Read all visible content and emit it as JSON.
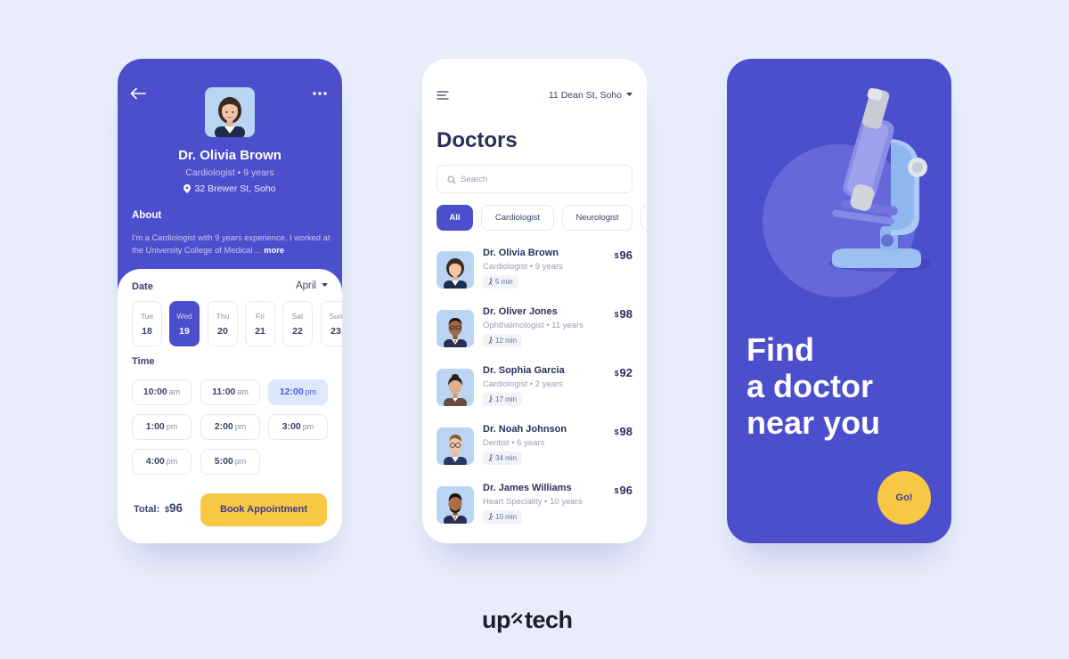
{
  "profile": {
    "name": "Dr. Olivia Brown",
    "specialty": "Cardiologist • 9 years",
    "location": "32 Brewer St, Soho",
    "about_title": "About",
    "about_text": "I'm a Cardiologist with 9 years experience. I worked at the University College of Medical ... ",
    "more_label": "more",
    "date_label": "Date",
    "month": "April",
    "days": [
      {
        "name": "Tue",
        "date": "18"
      },
      {
        "name": "Wed",
        "date": "19"
      },
      {
        "name": "Thu",
        "date": "20"
      },
      {
        "name": "Fri",
        "date": "21"
      },
      {
        "name": "Sat",
        "date": "22"
      },
      {
        "name": "Sun",
        "date": "23"
      }
    ],
    "time_label": "Time",
    "slots": [
      {
        "time": "10:00",
        "ampm": "am"
      },
      {
        "time": "11:00",
        "ampm": "am"
      },
      {
        "time": "12:00",
        "ampm": "pm"
      },
      {
        "time": "1:00",
        "ampm": "pm"
      },
      {
        "time": "2:00",
        "ampm": "pm"
      },
      {
        "time": "3:00",
        "ampm": "pm"
      },
      {
        "time": "4:00",
        "ampm": "pm"
      },
      {
        "time": "5:00",
        "ampm": "pm"
      }
    ],
    "total_label": "Total:",
    "total_currency": "$",
    "total_amount": "96",
    "book_label": "Book Appointment"
  },
  "list": {
    "location": "11 Dean St, Soho",
    "title": "Doctors",
    "search_placeholder": "Search",
    "chips": [
      "All",
      "Cardiologist",
      "Neurologist"
    ],
    "doctors": [
      {
        "name": "Dr. Olivia Brown",
        "specialty": "Cardiologist • 9 years",
        "time": "5 min",
        "currency": "$",
        "price": "96"
      },
      {
        "name": "Dr. Oliver Jones",
        "specialty": "Ophthalmologist • 11 years",
        "time": "12 min",
        "currency": "$",
        "price": "98"
      },
      {
        "name": "Dr. Sophia Garcia",
        "specialty": "Cardiologist • 2 years",
        "time": "17 min",
        "currency": "$",
        "price": "92"
      },
      {
        "name": "Dr. Noah Johnson",
        "specialty": "Dentist • 6 years",
        "time": "34 min",
        "currency": "$",
        "price": "98"
      },
      {
        "name": "Dr. James Williams",
        "specialty": "Heart Speciality • 10 years",
        "time": "10 min",
        "currency": "$",
        "price": "96"
      }
    ]
  },
  "hero": {
    "line1": "Find",
    "line2": "a doctor",
    "line3": "near you",
    "go_label": "Go!"
  },
  "brand": {
    "logo_left": "up",
    "logo_right": "tech"
  },
  "colors": {
    "primary": "#4b4fcc",
    "accent": "#f8c744",
    "background": "#e9edfb",
    "text": "#2c2f5a"
  }
}
